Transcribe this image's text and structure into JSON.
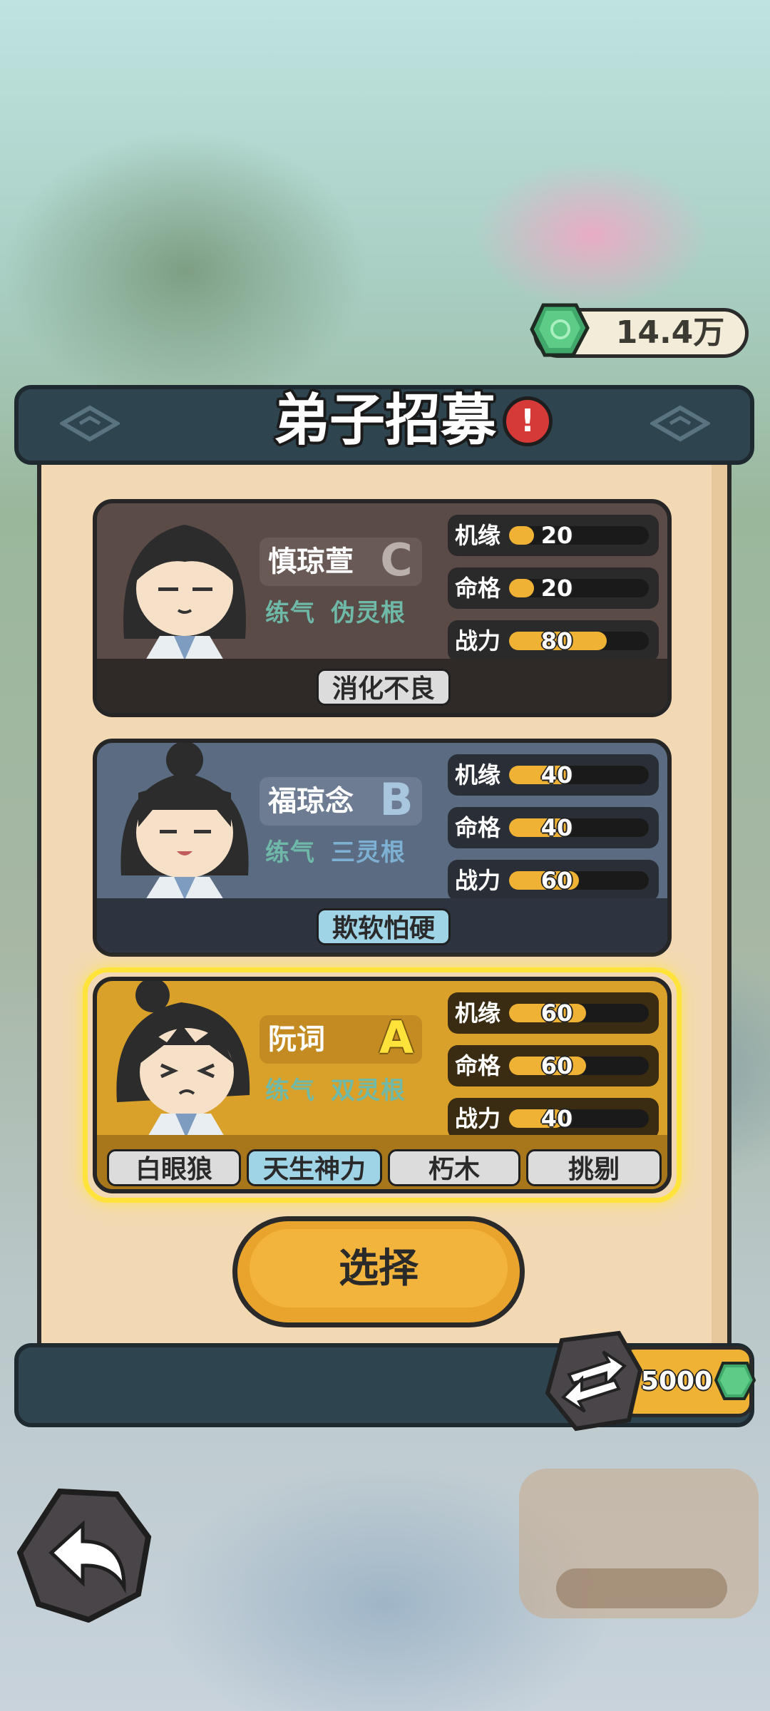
{
  "currency": {
    "value": "14.4万",
    "icon": "jade-gem-icon"
  },
  "panel": {
    "title": "弟子招募",
    "alert_icon": "!"
  },
  "disciples": [
    {
      "name": "慎琼萱",
      "grade": "C",
      "grade_color": "#b9b0aa",
      "realm": "练气",
      "root": "伪灵根",
      "stats": [
        {
          "label": "机缘",
          "value": "20",
          "percent": 18
        },
        {
          "label": "命格",
          "value": "20",
          "percent": 18
        },
        {
          "label": "战力",
          "value": "80",
          "percent": 70
        }
      ],
      "traits": [
        "消化不良"
      ]
    },
    {
      "name": "福琼念",
      "grade": "B",
      "grade_color": "#a9c6df",
      "realm": "练气",
      "root": "三灵根",
      "stats": [
        {
          "label": "机缘",
          "value": "40",
          "percent": 45
        },
        {
          "label": "命格",
          "value": "40",
          "percent": 45
        },
        {
          "label": "战力",
          "value": "60",
          "percent": 50
        }
      ],
      "traits": [
        "欺软怕硬"
      ]
    },
    {
      "name": "阮词",
      "grade": "A",
      "grade_color": "#ffe23a",
      "realm": "练气",
      "root": "双灵根",
      "stats": [
        {
          "label": "机缘",
          "value": "60",
          "percent": 55
        },
        {
          "label": "命格",
          "value": "60",
          "percent": 55
        },
        {
          "label": "战力",
          "value": "40",
          "percent": 40
        }
      ],
      "traits": [
        "白眼狼",
        "天生神力",
        "朽木",
        "挑剔"
      ]
    }
  ],
  "select_button": {
    "label": "选择"
  },
  "refresh": {
    "cost": "5000"
  },
  "colors": {
    "accent": "#f0b234",
    "panel": "#2e4550",
    "scroll": "#f2d9b3",
    "selected_glow": "#ffe23a"
  }
}
